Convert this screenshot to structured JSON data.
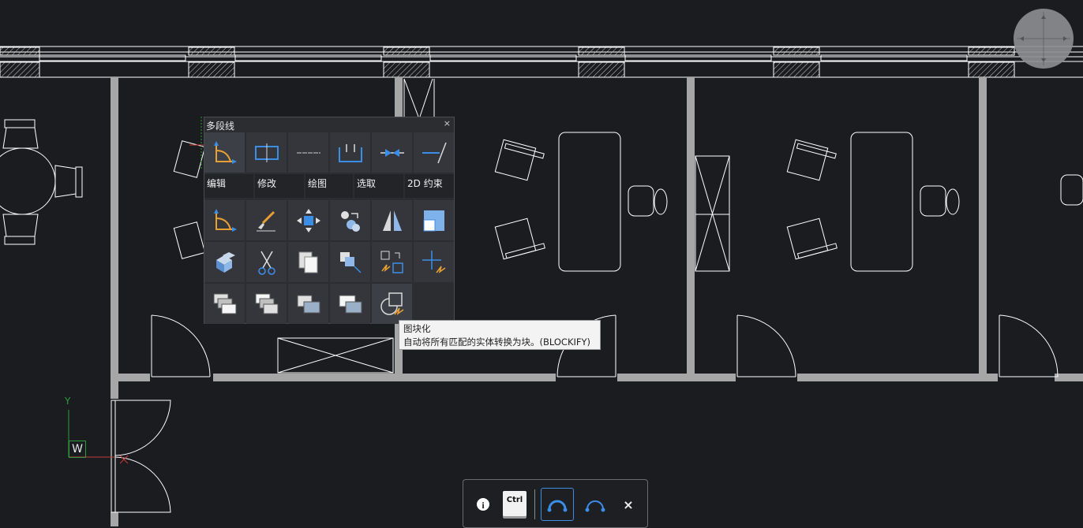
{
  "quad": {
    "title": "多段线",
    "close": "×",
    "tabs": [
      "编辑",
      "修改",
      "绘图",
      "选取",
      "2D 约束"
    ],
    "row1_icons": [
      "polyline-edit-icon",
      "rectangle-icon",
      "line-icon",
      "polyline-icon",
      "join-icon",
      "extend-icon"
    ],
    "grid_icons": [
      [
        "polyline-edit-icon",
        "paintbrush-icon",
        "move-icon",
        "match-properties-icon",
        "mirror-icon",
        "scale-icon"
      ],
      [
        "array-icon",
        "trim-icon",
        "copy-icon",
        "copy-move-icon",
        "replace-block-icon",
        "move-arrows-icon"
      ],
      [
        "draw-order-front-icon",
        "draw-order-back-icon",
        "draw-order-above-icon",
        "draw-order-below-icon",
        "blockify-icon"
      ]
    ]
  },
  "tooltip": {
    "title": "图块化",
    "description": "自动将所有匹配的实体转换为块。(BLOCKIFY)"
  },
  "ucs": {
    "y_label": "Y",
    "w_label": "W"
  },
  "bottombar": {
    "info_icon": "info-icon",
    "ctrl_label": "Ctrl",
    "close": "×"
  },
  "colors": {
    "background": "#1b1c20",
    "walls": "#a6a6a6",
    "accent_blue": "#3b8ee8",
    "ucs_green": "#2e9c3a",
    "ucs_red": "#c53a3a"
  }
}
